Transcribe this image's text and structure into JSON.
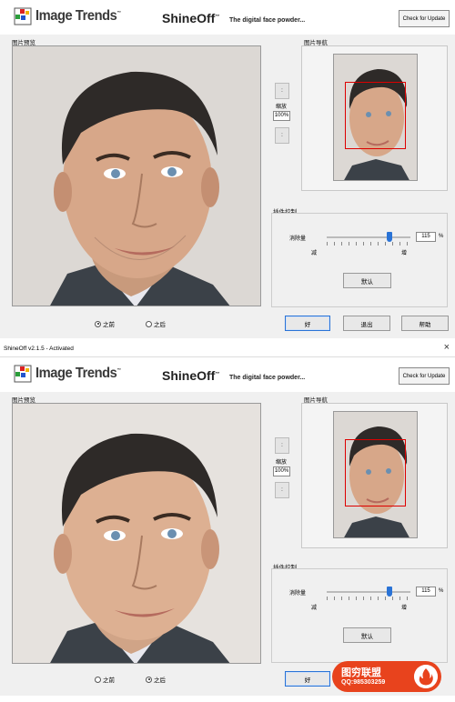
{
  "header": {
    "brand": "Image Trends",
    "tm": "™",
    "product": "ShineOff",
    "tagline": "The digital face powder...",
    "update_button": "Check for Update"
  },
  "sections": {
    "preview": "图片预览",
    "navigator": "图片导航",
    "plugin_control": "插件控制"
  },
  "zoom": {
    "up": ":",
    "label": "缩放",
    "value": "100%",
    "down": ":"
  },
  "slider": {
    "label": "消除量",
    "value": "115",
    "unit": "%",
    "min_label": "减",
    "max_label": "增",
    "level_fraction": 0.75
  },
  "buttons": {
    "default": "默认",
    "ok": "好",
    "exit": "退出",
    "help": "帮助"
  },
  "radio": {
    "before": "之前",
    "after": "之后"
  },
  "panels": [
    {
      "selected": "before"
    },
    {
      "selected": "after"
    }
  ],
  "window": {
    "title": "ShineOff v2.1.5 - Activated",
    "close": "×"
  },
  "watermark": {
    "title": "图穷联盟",
    "qq": "QQ:985303259"
  },
  "colors": {
    "accent": "#2a73d6",
    "nav_rect": "#dd0000",
    "watermark_bg": "#e8431d"
  }
}
